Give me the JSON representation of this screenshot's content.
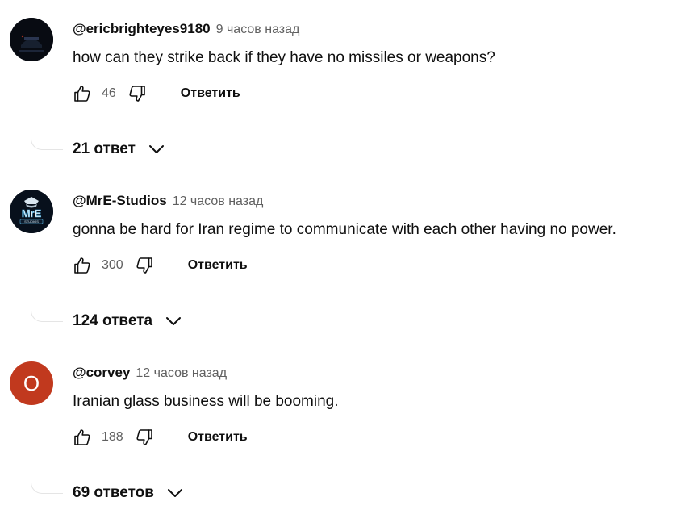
{
  "comments": [
    {
      "author": "@ericbrighteyes9180",
      "time": "9 часов назад",
      "text": "how can they strike back if they have no missiles or weapons?",
      "likes": "46",
      "reply_label": "Ответить",
      "replies_label": "21 ответ",
      "avatar_type": "dark-image"
    },
    {
      "author": "@MrE-Studios",
      "time": "12 часов назад",
      "text": "gonna be hard for Iran regime to communicate with each other having no power.",
      "likes": "300",
      "reply_label": "Ответить",
      "replies_label": "124 ответа",
      "avatar_type": "logo-image",
      "avatar_logo_text": "MrE",
      "avatar_logo_subtext": "STUDIOS"
    },
    {
      "author": "@corvey",
      "time": "12 часов назад",
      "text": "Iranian glass business will be booming.",
      "likes": "188",
      "reply_label": "Ответить",
      "replies_label": "69 ответов",
      "avatar_type": "letter",
      "avatar_letter": "O",
      "avatar_color": "#c1391e"
    }
  ],
  "icons": {
    "like": "thumbs-up-icon",
    "dislike": "thumbs-down-icon",
    "expand": "chevron-down-icon"
  },
  "colors": {
    "text_primary": "#0f0f0f",
    "text_secondary": "#606060",
    "thread_line": "#e5e5e5"
  }
}
